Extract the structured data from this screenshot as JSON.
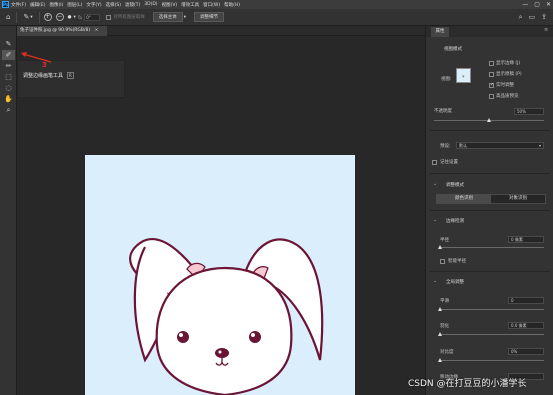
{
  "app": {
    "logo": "Ps"
  },
  "menu": {
    "items": [
      "文件(F)",
      "编辑(E)",
      "图像(I)",
      "图层(L)",
      "文字(Y)",
      "选择(S)",
      "滤镜(T)",
      "3D(D)",
      "视图(V)",
      "增效工具",
      "窗口(W)",
      "帮助(H)"
    ]
  },
  "window_controls": [
    "—",
    "▢",
    "✕"
  ],
  "options_bar": {
    "icons": {
      "home": "home-icon",
      "brush": "brush-icon",
      "refine": "refine-brush-icon",
      "search": "search-icon"
    },
    "size_value": "0°",
    "sample_all_layers": "对所有图层取样",
    "select_subject": "选择主体",
    "select_and_mask": "调整细节"
  },
  "document": {
    "tab_title": "兔子证件照.jpg @ 90.9%(RGB/8)",
    "tab_close": "×"
  },
  "tooltip": {
    "label": "调整边缘画笔工具",
    "shortcut": "R",
    "callout_number": "3"
  },
  "toolbar": {
    "icons": [
      "quick-selection-icon",
      "refine-edge-brush-icon",
      "brush-icon",
      "object-selection-icon",
      "lasso-icon",
      "hand-icon",
      "zoom-icon"
    ]
  },
  "properties": {
    "tab": "属性",
    "view_mode": {
      "title": "视图模式",
      "view_label": "视图:",
      "show_edge": "显示边缘 (J)",
      "show_original": "显示原稿 (P)",
      "realtime_refine": "实时调整",
      "high_quality_preview": "高品质预览"
    },
    "transparency": {
      "label": "不透明度",
      "value": "50%",
      "fraction": 0.5
    },
    "preset": {
      "label": "预设:",
      "value": "默认"
    },
    "remember_settings": "记住设置",
    "refine_mode": {
      "title": "调整模式",
      "color_aware": "颜色识别",
      "object_aware": "对象识别"
    },
    "edge_detection": {
      "title": "边缘检测",
      "radius_label": "半径",
      "radius_value": "0 像素",
      "smart_radius": "智能半径"
    },
    "global_refinements": {
      "title": "全局调整",
      "smooth_label": "平滑",
      "smooth_value": "0",
      "feather_label": "羽化",
      "feather_value": "0.0 像素",
      "contrast_label": "对比度",
      "contrast_value": "0%",
      "shift_edge_label": "移动边缘"
    }
  },
  "watermark": "CSDN @在打豆豆的小潘学长",
  "colors": {
    "accent": "#31a8ff",
    "callout": "#e03020",
    "artboard": "#dbeefb",
    "bunny_outline": "#6b1436",
    "ear_inner": "#f6c9d2"
  }
}
